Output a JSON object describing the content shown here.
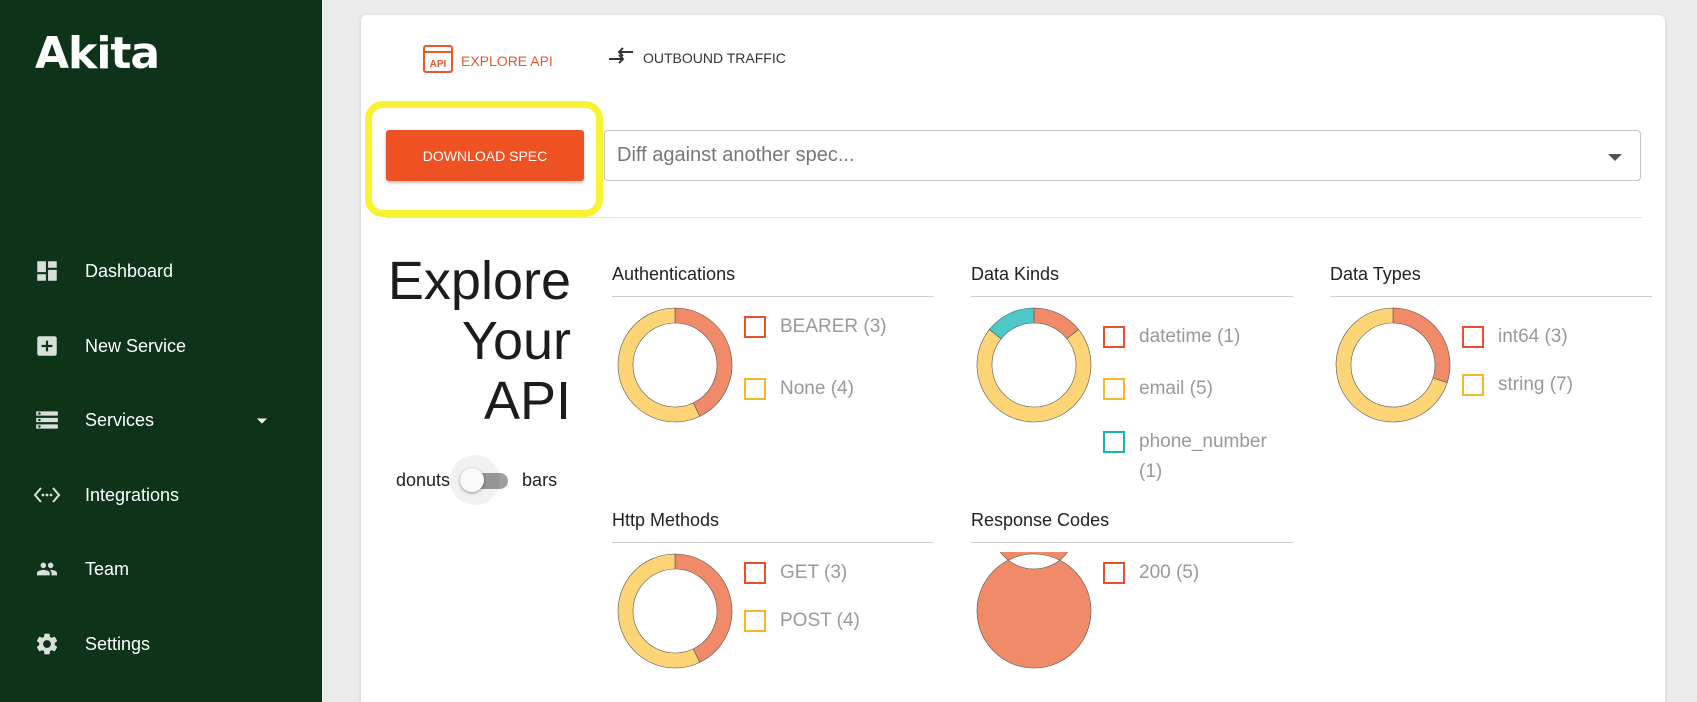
{
  "app": {
    "logo": "Akita"
  },
  "sidebar": {
    "items": [
      {
        "label": "Dashboard",
        "icon": "dashboard-icon"
      },
      {
        "label": "New Service",
        "icon": "add-box-icon"
      },
      {
        "label": "Services",
        "icon": "storage-icon",
        "has_dropdown": true
      },
      {
        "label": "Integrations",
        "icon": "code-icon"
      },
      {
        "label": "Team",
        "icon": "people-icon"
      },
      {
        "label": "Settings",
        "icon": "gear-icon"
      }
    ]
  },
  "tabs": [
    {
      "label": "EXPLORE API",
      "icon": "api-icon",
      "active": true
    },
    {
      "label": "OUTBOUND TRAFFIC",
      "icon": "swap-arrows-icon",
      "active": false
    }
  ],
  "toolbar": {
    "download_label": "DOWNLOAD SPEC",
    "diff_placeholder": "Diff against another spec..."
  },
  "explore": {
    "title_lines": [
      "Explore",
      "Your",
      "API"
    ],
    "toggle_left": "donuts",
    "toggle_right": "bars"
  },
  "colors": {
    "sidebar_bg": "#0d3318",
    "accent": "#ee5222",
    "highlight": "#f7f332",
    "slice_orange": "#f08a68",
    "slice_yellow": "#fdd476",
    "slice_teal": "#4cc8c8",
    "box_orange": "#e8502a",
    "box_yellow": "#f5b630",
    "box_teal": "#18b4b4"
  },
  "chart_data": [
    {
      "type": "pie",
      "title": "Authentications",
      "categories": [
        "BEARER (3)",
        "None (4)"
      ],
      "values": [
        3,
        4
      ],
      "slice_colors": [
        "#f08a68",
        "#fdd476"
      ],
      "box_colors": [
        "#e8502a",
        "#f5b630"
      ]
    },
    {
      "type": "pie",
      "title": "Data Kinds",
      "categories": [
        "datetime (1)",
        "email (5)",
        "phone_number (1)"
      ],
      "values": [
        1,
        5,
        1
      ],
      "slice_colors": [
        "#f08a68",
        "#fdd476",
        "#4cc8c8"
      ],
      "box_colors": [
        "#e8502a",
        "#f5b630",
        "#18b4b4"
      ]
    },
    {
      "type": "pie",
      "title": "Data Types",
      "categories": [
        "int64 (3)",
        "string (7)"
      ],
      "values": [
        3,
        7
      ],
      "slice_colors": [
        "#f08a68",
        "#fdd476"
      ],
      "box_colors": [
        "#e8502a",
        "#f5b630"
      ]
    },
    {
      "type": "pie",
      "title": "Http Methods",
      "categories": [
        "GET (3)",
        "POST (4)"
      ],
      "values": [
        3,
        4
      ],
      "slice_colors": [
        "#f08a68",
        "#fdd476"
      ],
      "box_colors": [
        "#e8502a",
        "#f5b630"
      ]
    },
    {
      "type": "pie",
      "title": "Response Codes",
      "categories": [
        "200 (5)"
      ],
      "values": [
        5
      ],
      "slice_colors": [
        "#f08a68"
      ],
      "box_colors": [
        "#e8502a"
      ]
    }
  ]
}
